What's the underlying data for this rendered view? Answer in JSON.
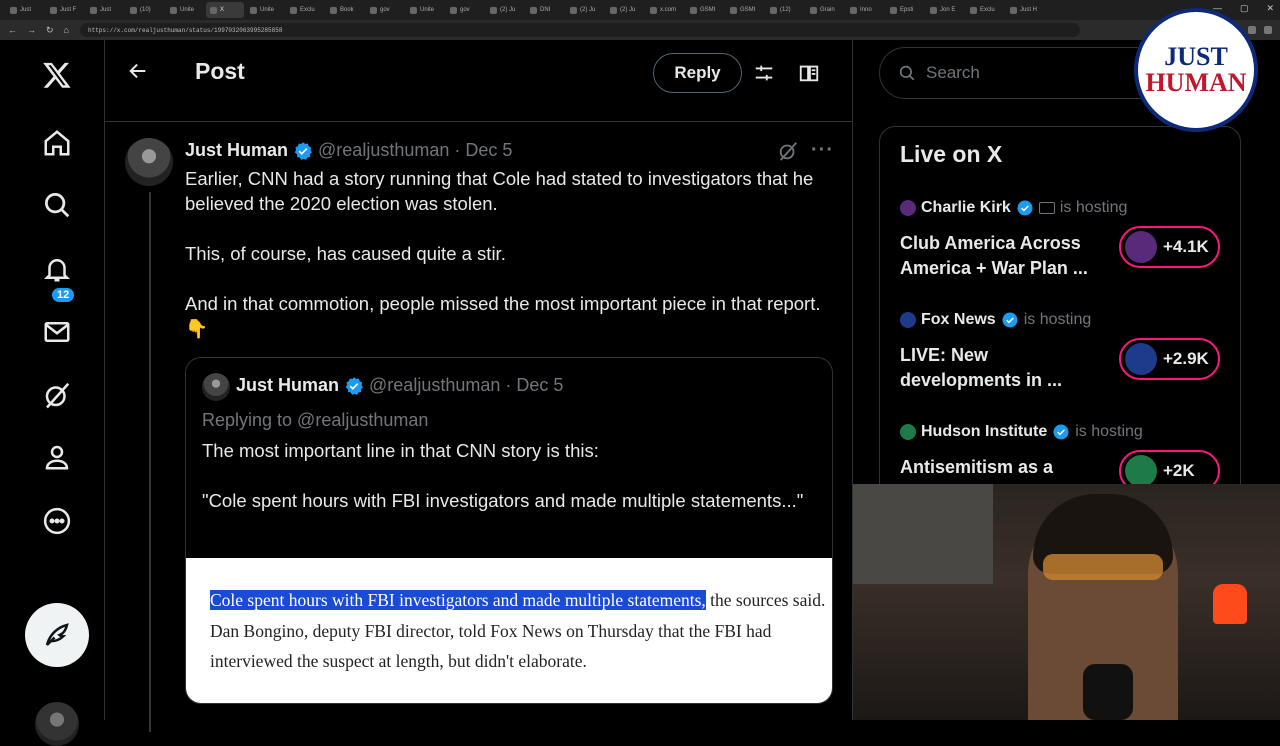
{
  "browser": {
    "tabs": [
      "Just",
      "Just F",
      "Just",
      "(10)",
      "Unite",
      "X",
      "Unite",
      "Exclu",
      "Book",
      "gov",
      "Unite",
      "gov",
      "(2) Ju",
      "DNI",
      "(2) Ju",
      "(2) Ju",
      "x.com",
      "GSMI",
      "GSMI",
      "(12)",
      "Grain",
      "Inno",
      "Epsti",
      "Jon E",
      "Exclu",
      "Just H"
    ],
    "active_tab_index": 5,
    "url": "https://x.com/realjusthuman/status/1997032063995285858"
  },
  "nav": {
    "notifications_badge": "12"
  },
  "header": {
    "title": "Post",
    "reply_label": "Reply"
  },
  "tweet": {
    "name": "Just Human",
    "handle": "@realjusthuman",
    "date": "· Dec 5",
    "text": "Earlier, CNN had a story running that Cole had stated to investigators that he believed the 2020 election was stolen.\n\nThis, of course, has caused quite a stir.\n\nAnd in that commotion, people missed the most important piece in that report. 👇"
  },
  "quote": {
    "name": "Just Human",
    "handle": "@realjusthuman",
    "date": "· Dec 5",
    "replying_to": "Replying to @realjusthuman",
    "text": "The most important line in that CNN story is this:\n\n\"Cole spent hours with FBI investigators and made multiple statements...\"",
    "image_highlight": "Cole spent hours with FBI investigators and made multiple statements,",
    "image_rest": " the sources said. Dan Bongino, deputy FBI director, told Fox News on Thursday that the FBI had interviewed the suspect at length, but didn't elaborate."
  },
  "sidebar": {
    "search_placeholder": "Search",
    "live_title": "Live on X",
    "hosting_label": "is hosting",
    "live": [
      {
        "host": "Charlie Kirk",
        "title": "Club America Across America + War Plan ...",
        "count": "+4.1K",
        "color": "#5a2a7a"
      },
      {
        "host": "Fox News",
        "title": "LIVE: New developments in ...",
        "count": "+2.9K",
        "color": "#1d3b8a"
      },
      {
        "host": "Hudson Institute",
        "title": "Antisemitism as a",
        "count": "+2K",
        "color": "#1f7a4a"
      }
    ]
  },
  "overlay_logo": {
    "line1": "JUST",
    "line2": "HUMAN"
  },
  "colors": {
    "accent": "#1d9bf0",
    "live_ring": "#f91880",
    "highlight": "#1a4bd4"
  }
}
